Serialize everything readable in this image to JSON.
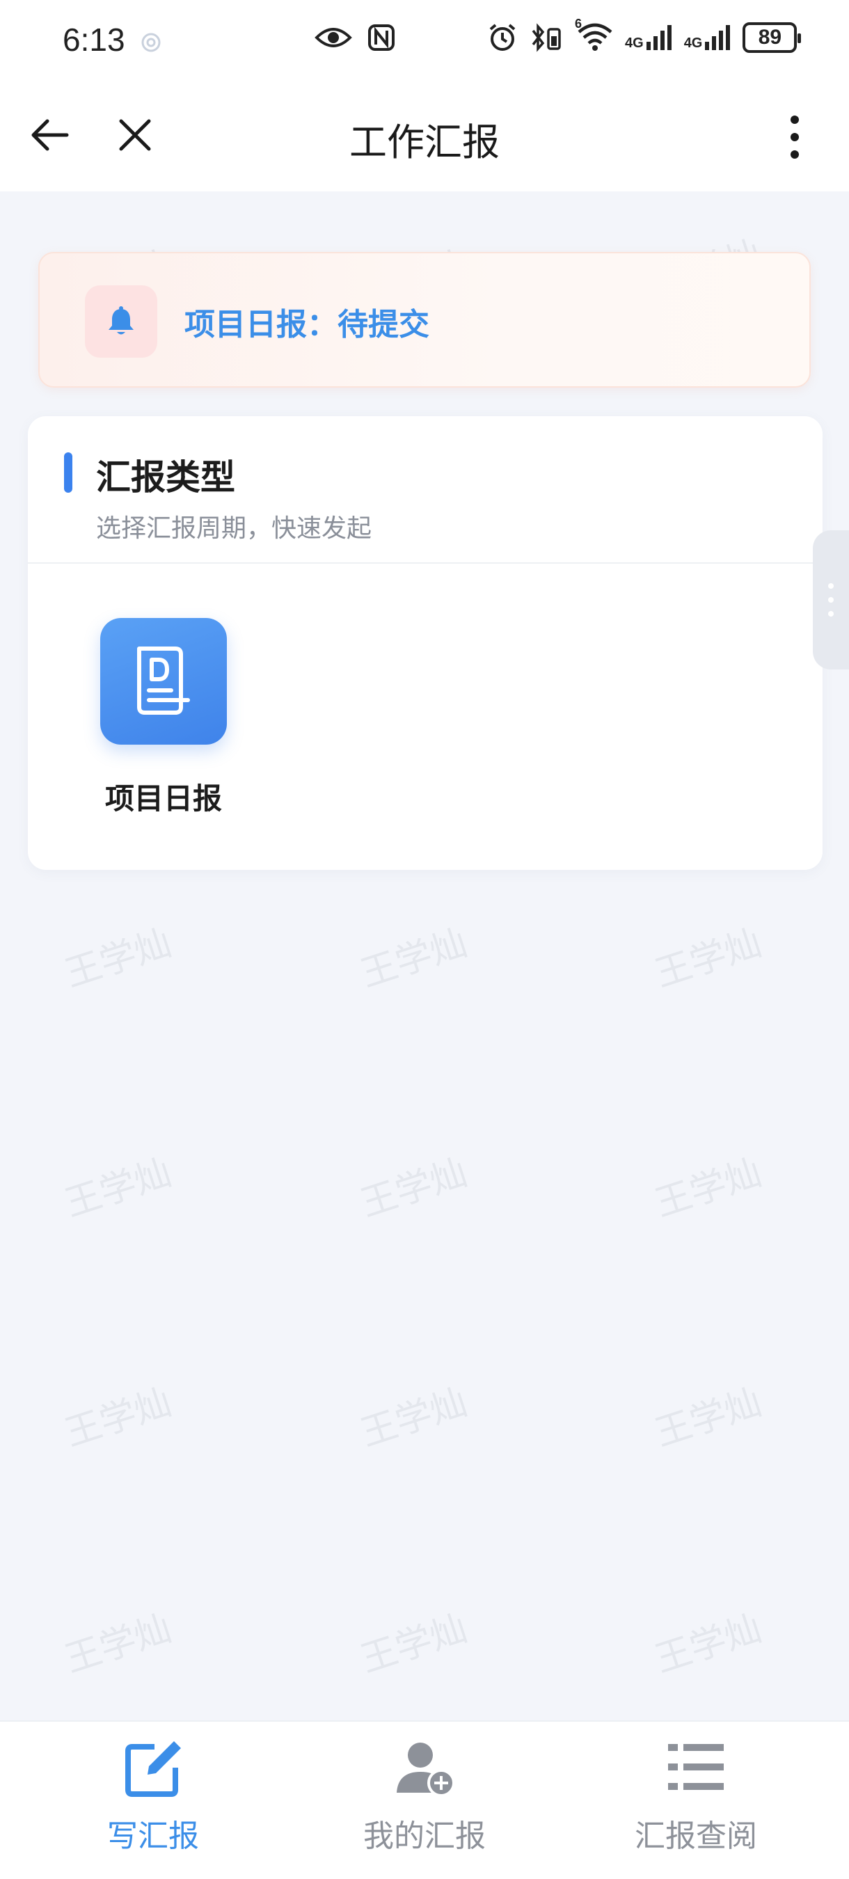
{
  "status_bar": {
    "time": "6:13",
    "signal_1": "4G",
    "signal_2": "4G",
    "wifi_tag": "6",
    "battery": "89"
  },
  "header": {
    "title": "工作汇报"
  },
  "notice": {
    "text": "项目日报：待提交",
    "color": "#3b8ee8"
  },
  "types": {
    "heading": "汇报类型",
    "subheading": "选择汇报周期，快速发起",
    "items": [
      {
        "label": "项目日报",
        "icon": "daily-report-icon"
      }
    ]
  },
  "watermark": {
    "text": "王学灿"
  },
  "tabbar": {
    "tabs": [
      {
        "label": "写汇报",
        "icon": "edit-icon",
        "active": true
      },
      {
        "label": "我的汇报",
        "icon": "user-add-icon",
        "active": false
      },
      {
        "label": "汇报查阅",
        "icon": "list-icon",
        "active": false
      }
    ]
  },
  "colors": {
    "accent": "#3b82ee",
    "tab_active": "#3b8ee8",
    "tab_inactive": "#8d9199"
  }
}
